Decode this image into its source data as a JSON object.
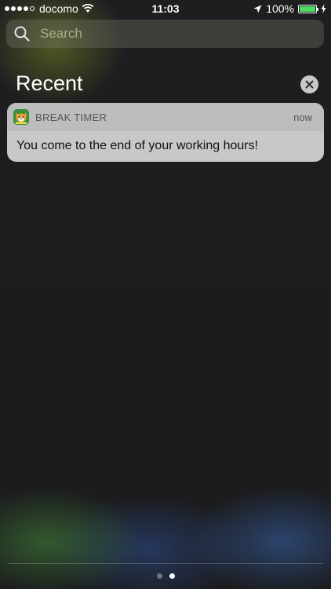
{
  "status_bar": {
    "carrier": "docomo",
    "time": "11:03",
    "battery_text": "100%",
    "battery_level": 1.0,
    "signal_bars_filled": 4,
    "signal_bars_total": 5
  },
  "search": {
    "placeholder": "Search"
  },
  "recent": {
    "title": "Recent"
  },
  "notification": {
    "app_name": "BREAK TIMER",
    "time": "now",
    "message": "You come to the end of your working hours!",
    "icon": "shiba-dog-icon"
  },
  "page_indicator": {
    "count": 2,
    "active_index": 1
  },
  "colors": {
    "battery_fill": "#4cd964",
    "card_background": "#c8c8c8",
    "card_header": "#bdbdbd"
  }
}
